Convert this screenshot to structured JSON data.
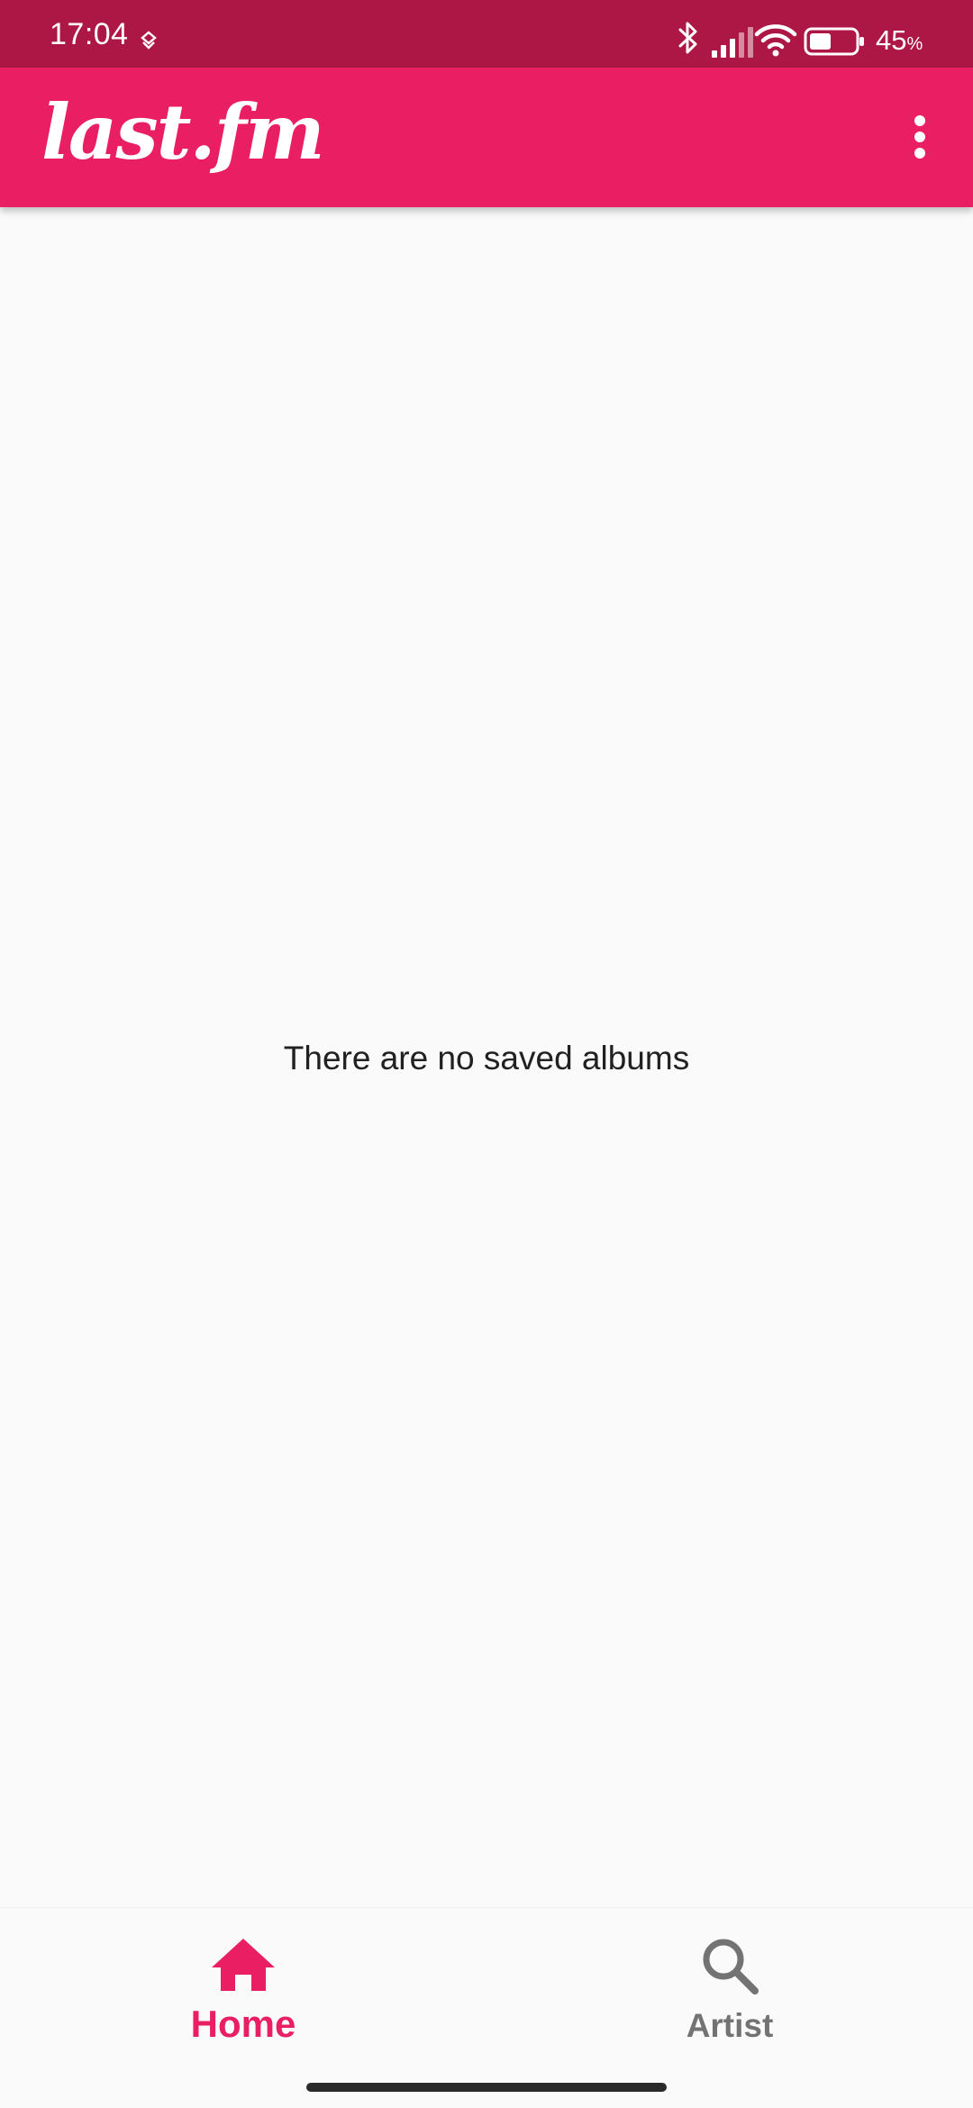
{
  "status_bar": {
    "time": "17:04",
    "battery_level": "45",
    "battery_unit": "%",
    "icons": [
      "notification-app-icon",
      "bluetooth-icon",
      "signal-icon",
      "wifi-icon",
      "battery-icon"
    ],
    "background_color": "#ad1746"
  },
  "app_bar": {
    "logo_text": "last.fm",
    "menu_icon": "more-vert-icon",
    "background_color": "#ea1e63"
  },
  "main": {
    "empty_message": "There are no saved albums"
  },
  "bottom_nav": {
    "items": [
      {
        "label": "Home",
        "icon": "home-icon",
        "selected": true,
        "color": "#ea1e63"
      },
      {
        "label": "Artist",
        "icon": "search-icon",
        "selected": false,
        "color": "#737373"
      }
    ]
  }
}
